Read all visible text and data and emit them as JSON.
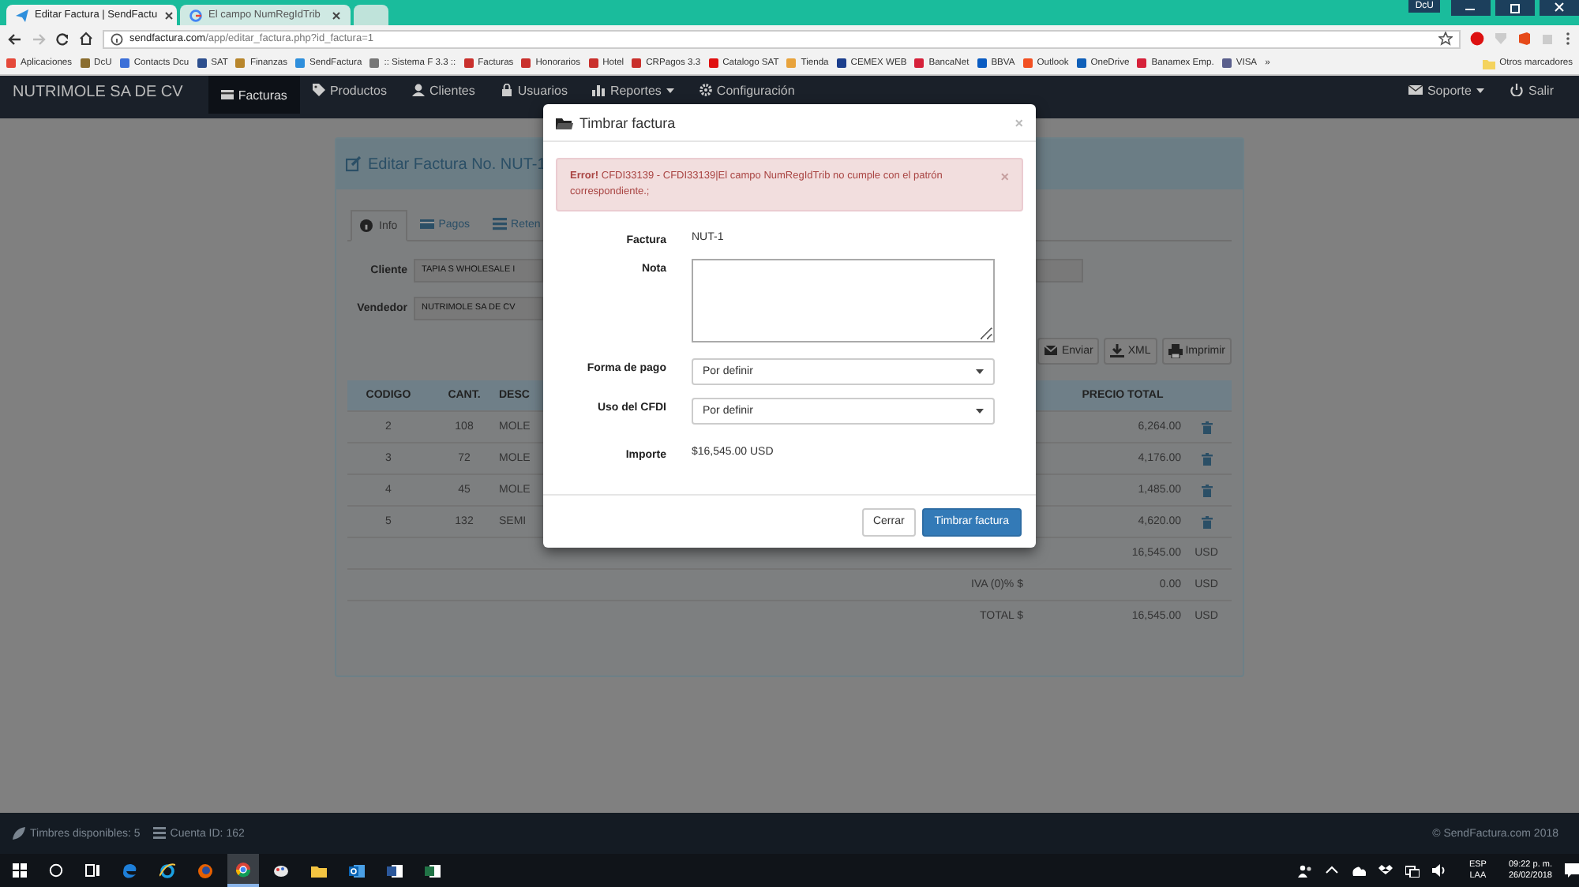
{
  "browser": {
    "tabs": [
      {
        "title": "Editar Factura | SendFactu",
        "selected": true
      },
      {
        "title": "El campo NumRegIdTrib",
        "selected": false
      }
    ],
    "profile": "DcU",
    "address": {
      "host": "sendfactura.com",
      "path": "/app/editar_factura.php?id_factura=1"
    },
    "bookmarks": [
      {
        "label": "Aplicaciones",
        "color": "#e5493a"
      },
      {
        "label": "DcU",
        "color": "#8a6d2f"
      },
      {
        "label": "Contacts Dcu",
        "color": "#3b6fd8"
      },
      {
        "label": "SAT",
        "color": "#2d4f8e"
      },
      {
        "label": "Finanzas",
        "color": "#b8862c"
      },
      {
        "label": "SendFactura",
        "color": "#2f8fdc"
      },
      {
        "label": ":: Sistema F 3.3 ::",
        "color": "#777777"
      },
      {
        "label": "Facturas",
        "color": "#c9302c"
      },
      {
        "label": "Honorarios",
        "color": "#c9302c"
      },
      {
        "label": "Hotel",
        "color": "#c9302c"
      },
      {
        "label": "CRPagos 3.3",
        "color": "#c9302c"
      },
      {
        "label": "Catalogo SAT",
        "color": "#e01010"
      },
      {
        "label": "Tienda",
        "color": "#e8a33c"
      },
      {
        "label": "CEMEX WEB",
        "color": "#1b3e8c"
      },
      {
        "label": "BancaNet",
        "color": "#d6213a"
      },
      {
        "label": "BBVA",
        "color": "#0a5cc2"
      },
      {
        "label": "Outlook",
        "color": "#f25022"
      },
      {
        "label": "OneDrive",
        "color": "#0f5fb8"
      },
      {
        "label": "Banamex Emp.",
        "color": "#d6213a"
      },
      {
        "label": "VISA",
        "color": "#5a5f8c"
      }
    ],
    "more": "»",
    "other_bookmarks": "Otros marcadores"
  },
  "navbar": {
    "brand": "NUTRIMOLE SA DE CV",
    "items": [
      {
        "label": "Facturas",
        "selected": true,
        "kind": "link"
      },
      {
        "label": "Productos",
        "selected": false,
        "kind": "link"
      },
      {
        "label": "Clientes",
        "selected": false,
        "kind": "link"
      },
      {
        "label": "Usuarios",
        "selected": false,
        "kind": "link"
      },
      {
        "label": "Reportes",
        "selected": false,
        "kind": "dropdown"
      },
      {
        "label": "Configuración",
        "selected": false,
        "kind": "link"
      }
    ],
    "right_items": [
      {
        "label": "Soporte",
        "kind": "dropdown"
      },
      {
        "label": "Salir",
        "kind": "link"
      }
    ]
  },
  "page": {
    "title": "Editar Factura No. NUT-1",
    "tabs": [
      {
        "label": "Info",
        "selected": true
      },
      {
        "label": "Pagos",
        "selected": false
      },
      {
        "label": "Reten",
        "selected": false
      }
    ],
    "cliente": {
      "label": "Cliente",
      "value": "TAPIA S WHOLESALE I"
    },
    "vendedor": {
      "label": "Vendedor",
      "value": "NUTRIMOLE SA DE CV"
    },
    "actions": [
      "Enviar",
      "XML",
      "Imprimir"
    ],
    "table": {
      "columns": [
        "CODIGO",
        "CANT.",
        "DESC",
        "PRECIO TOTAL"
      ],
      "rows": [
        {
          "codigo": "2",
          "cant": "108",
          "desc": "MOLE",
          "precio": "6,264.00"
        },
        {
          "codigo": "3",
          "cant": "72",
          "desc": "MOLE",
          "precio": "4,176.00"
        },
        {
          "codigo": "4",
          "cant": "45",
          "desc": "MOLE",
          "precio": "1,485.00"
        },
        {
          "codigo": "5",
          "cant": "132",
          "desc": "SEMI",
          "precio": "4,620.00"
        }
      ]
    },
    "totals": [
      {
        "amount": "16,545.00",
        "currency": "USD"
      },
      {
        "label": "IVA (0)% $",
        "amount": "0.00",
        "currency": "USD"
      },
      {
        "label": "TOTAL $",
        "amount": "16,545.00",
        "currency": "USD"
      }
    ]
  },
  "modal": {
    "title": "Timbrar factura",
    "close": "×",
    "alert": {
      "text": "**Error!** CFDI33139 - CFDI33139|El campo NumRegIdTrib no cumple con el patrón correspondiente.;",
      "close": "×"
    },
    "factura": {
      "label": "Factura",
      "value": "NUT-1"
    },
    "nota": {
      "label": "Nota"
    },
    "forma_pago": {
      "label": "Forma de pago",
      "value": "Por definir"
    },
    "uso_cfdi": {
      "label": "Uso del CFDI",
      "value": "Por definir"
    },
    "importe": {
      "label": "Importe",
      "value": "$16,545.00 USD"
    },
    "buttons": [
      {
        "label": "Cerrar",
        "kind": "default"
      },
      {
        "label": "Timbrar factura",
        "kind": "primary"
      }
    ]
  },
  "footer": {
    "timbres": "Timbres disponibles: 5",
    "cuenta": "Cuenta ID: 162",
    "copyright": "© SendFactura.com 2018"
  },
  "taskbar": {
    "apps": [
      {
        "kind": "edge",
        "active": false
      },
      {
        "kind": "ie",
        "active": false
      },
      {
        "kind": "firefox",
        "active": false
      },
      {
        "kind": "chrome",
        "active": true
      },
      {
        "kind": "paint",
        "active": false
      },
      {
        "kind": "folder",
        "active": false
      },
      {
        "kind": "outlook",
        "active": false
      },
      {
        "kind": "word",
        "active": false
      },
      {
        "kind": "excel",
        "active": false
      }
    ],
    "language": [
      "ESP",
      "LAA"
    ],
    "time": "09:22 p. m.",
    "date": "26/02/2018"
  }
}
